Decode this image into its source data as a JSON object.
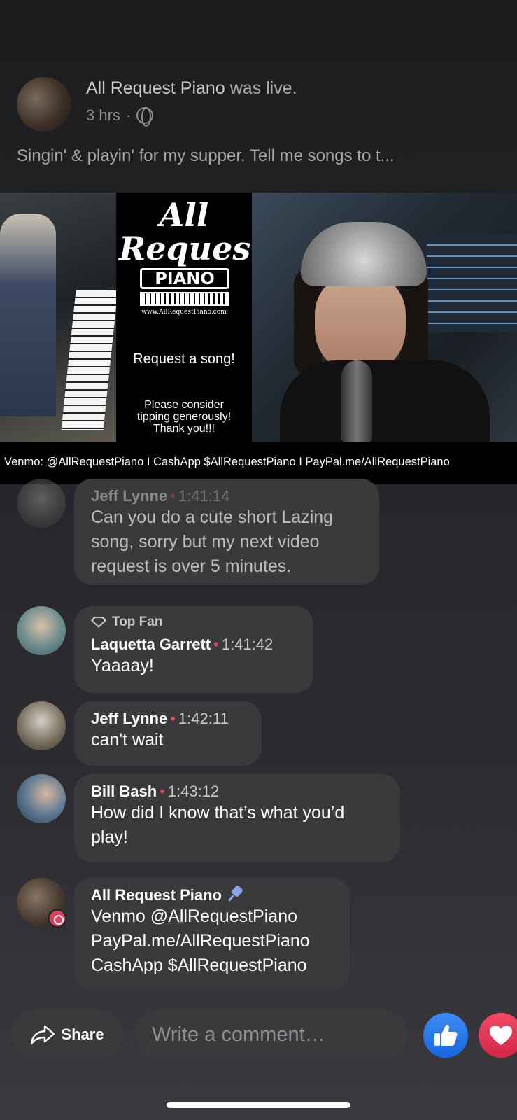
{
  "post": {
    "author": "All Request Piano",
    "status": "was live.",
    "time": "3 hrs",
    "separator": "·",
    "caption": "Singin' & playin' for my supper. Tell me songs to t..."
  },
  "video": {
    "logo_line1": "All",
    "logo_line2": "Request",
    "logo_piano": "PIANO",
    "logo_url": "www.AllRequestPiano.com",
    "request_text": "Request a song!",
    "tip_line1": "Please consider",
    "tip_line2": "tipping generously!",
    "tip_line3": "Thank you!!!",
    "banner": "Venmo: @AllRequestPiano  I  CashApp $AllRequestPiano  I  PayPal.me/AllRequestPiano"
  },
  "comments": [
    {
      "name": "Jeff Lynne",
      "time": "1:41:14",
      "text": "Can you do a cute short Lazing song, sorry but my next video request is over 5 minutes."
    },
    {
      "badge": "Top Fan",
      "name": "Laquetta Garrett",
      "time": "1:41:42",
      "text": "Yaaaay!"
    },
    {
      "name": "Jeff Lynne",
      "time": "1:42:11",
      "text": "can't wait"
    },
    {
      "name": "Bill Bash",
      "time": "1:43:12",
      "text": "How did I know that’s what you’d play!"
    },
    {
      "name": "All Request Piano",
      "line1": "Venmo @AllRequestPiano",
      "line2": "PayPal.me/AllRequestPiano",
      "line3": "CashApp $AllRequestPiano"
    }
  ],
  "bottom": {
    "share_label": "Share",
    "comment_placeholder": "Write a comment…"
  },
  "colors": {
    "accent_dot": "#e0445a",
    "like": "#1767e0",
    "heart": "#d1264a"
  }
}
